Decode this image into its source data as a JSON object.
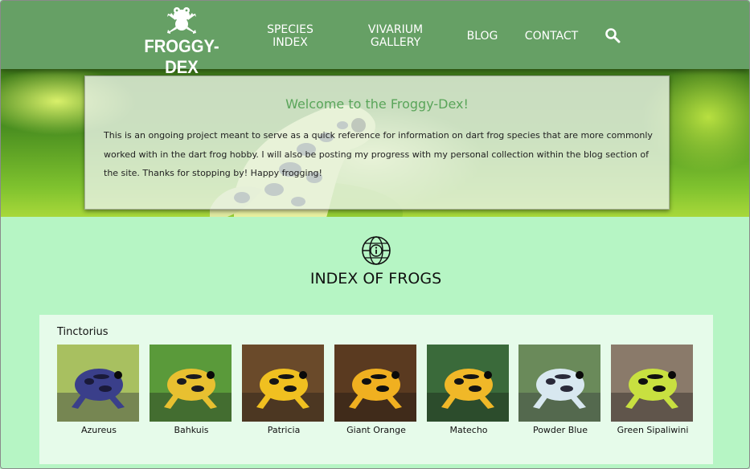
{
  "site": {
    "logo_text": "FROGGY-DEX"
  },
  "nav": {
    "species_line1": "SPECIES",
    "species_line2": "INDEX",
    "gallery_line1": "VIVARIUM",
    "gallery_line2": "GALLERY",
    "blog": "BLOG",
    "contact": "CONTACT",
    "search_icon": "search-icon"
  },
  "hero": {
    "title": "Welcome to the Froggy-Dex!",
    "body": "This is an ongoing project meant to serve as a quick reference for information on dart frog species that are more commonly worked with in the dart frog hobby. I will also be posting my progress with my personal collection within the blog section of the site. Thanks for stopping by! Happy frogging!"
  },
  "index": {
    "icon": "globe-info-icon",
    "title": "INDEX OF FROGS",
    "group": {
      "name": "Tinctorius",
      "frogs": [
        {
          "name": "Azureus",
          "colors": [
            "#3a3f8a",
            "#1a1a3a",
            "#a8c060"
          ]
        },
        {
          "name": "Bahkuis",
          "colors": [
            "#e8c030",
            "#1a1a20",
            "#5a9a3a"
          ]
        },
        {
          "name": "Patricia",
          "colors": [
            "#f0c020",
            "#151515",
            "#6a4a2a"
          ]
        },
        {
          "name": "Giant Orange",
          "colors": [
            "#f0b020",
            "#101010",
            "#5a3a20"
          ]
        },
        {
          "name": "Matecho",
          "colors": [
            "#f0b828",
            "#141414",
            "#3a6a3a"
          ]
        },
        {
          "name": "Powder Blue",
          "colors": [
            "#d8e8f0",
            "#2a2a3a",
            "#6a8a5a"
          ]
        },
        {
          "name": "Green Sipaliwini",
          "colors": [
            "#c8e040",
            "#101010",
            "#8a7a6a"
          ]
        }
      ]
    }
  },
  "colors": {
    "header_bg": "#66a065",
    "page_bg": "#b6f5c4",
    "card_bg": "#e6fbea",
    "accent_title": "#5aa55a"
  }
}
